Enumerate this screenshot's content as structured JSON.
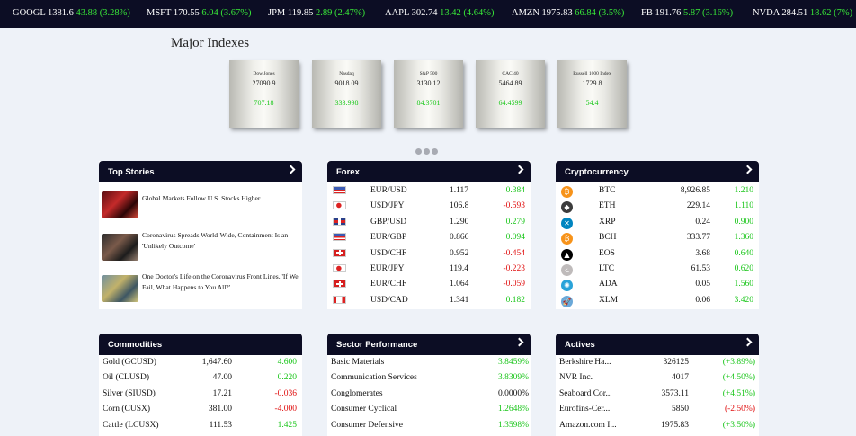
{
  "ticker": [
    {
      "sym": "GOOGL",
      "price": "1381.6",
      "chg": "43.88 (3.28%)"
    },
    {
      "sym": "MSFT",
      "price": "170.55",
      "chg": "6.04 (3.67%)"
    },
    {
      "sym": "JPM",
      "price": "119.85",
      "chg": "2.89 (2.47%)"
    },
    {
      "sym": "AAPL",
      "price": "302.74",
      "chg": "13.42 (4.64%)"
    },
    {
      "sym": "AMZN",
      "price": "1975.83",
      "chg": "66.84 (3.5%)"
    },
    {
      "sym": "FB",
      "price": "191.76",
      "chg": "5.87 (3.16%)"
    },
    {
      "sym": "NVDA",
      "price": "284.51",
      "chg": "18.62 (7%)"
    }
  ],
  "indexes": {
    "title": "Major Indexes",
    "items": [
      {
        "name": "Dow Jones",
        "value": "27090.9",
        "change": "707.18"
      },
      {
        "name": "Nasdaq",
        "value": "9018.09",
        "change": "333.998"
      },
      {
        "name": "S&P 500",
        "value": "3130.12",
        "change": "84.3701"
      },
      {
        "name": "CAC 40",
        "value": "5464.89",
        "change": "64.4599"
      },
      {
        "name": "Russell 1000 Index",
        "value": "1729.8",
        "change": "54.4"
      }
    ]
  },
  "top_stories": {
    "title": "Top Stories",
    "items": [
      {
        "headline": "Global Markets Follow U.S. Stocks Higher",
        "thumb_icon": "market-screen-thumbnail"
      },
      {
        "headline": "Coronavirus Spreads World-Wide, Containment Is an 'Unlikely Outcome'",
        "thumb_icon": "crowd-masks-thumbnail"
      },
      {
        "headline": "One Doctor's Life on the Coronavirus Front Lines. 'If We Fail, What Happens to You All?'",
        "thumb_icon": "doctor-thumbnail"
      }
    ]
  },
  "forex": {
    "title": "Forex",
    "rows": [
      {
        "pair": "EUR/USD",
        "rate": "1.117",
        "change": "0.384",
        "dir": "pos"
      },
      {
        "pair": "USD/JPY",
        "rate": "106.8",
        "change": "-0.593",
        "dir": "neg"
      },
      {
        "pair": "GBP/USD",
        "rate": "1.290",
        "change": "0.279",
        "dir": "pos"
      },
      {
        "pair": "EUR/GBP",
        "rate": "0.866",
        "change": "0.094",
        "dir": "pos"
      },
      {
        "pair": "USD/CHF",
        "rate": "0.952",
        "change": "-0.454",
        "dir": "neg"
      },
      {
        "pair": "EUR/JPY",
        "rate": "119.4",
        "change": "-0.223",
        "dir": "neg"
      },
      {
        "pair": "EUR/CHF",
        "rate": "1.064",
        "change": "-0.059",
        "dir": "neg"
      },
      {
        "pair": "USD/CAD",
        "rate": "1.341",
        "change": "0.182",
        "dir": "pos"
      }
    ]
  },
  "crypto": {
    "title": "Cryptocurrency",
    "rows": [
      {
        "sym": "BTC",
        "price": "8,926.85",
        "change": "1.210",
        "color": "#f7931a",
        "glyph": "₿"
      },
      {
        "sym": "ETH",
        "price": "229.14",
        "change": "1.110",
        "color": "#3c3c3d",
        "glyph": "◆"
      },
      {
        "sym": "XRP",
        "price": "0.24",
        "change": "0.900",
        "color": "#0085c0",
        "glyph": "✕"
      },
      {
        "sym": "BCH",
        "price": "333.77",
        "change": "1.360",
        "color": "#f7931a",
        "glyph": "₿"
      },
      {
        "sym": "EOS",
        "price": "3.68",
        "change": "0.640",
        "color": "#000000",
        "glyph": "▲"
      },
      {
        "sym": "LTC",
        "price": "61.53",
        "change": "0.620",
        "color": "#bfbbbb",
        "glyph": "Ł"
      },
      {
        "sym": "ADA",
        "price": "0.05",
        "change": "1.560",
        "color": "#2aa3d9",
        "glyph": "✺"
      },
      {
        "sym": "XLM",
        "price": "0.06",
        "change": "3.420",
        "color": "#6aa8d8",
        "glyph": "🚀"
      }
    ]
  },
  "commodities": {
    "title": "Commodities",
    "rows": [
      {
        "name": "Gold (GCUSD)",
        "price": "1,647.60",
        "change": "4.600",
        "dir": "pos"
      },
      {
        "name": "Oil (CLUSD)",
        "price": "47.00",
        "change": "0.220",
        "dir": "pos"
      },
      {
        "name": "Silver (SIUSD)",
        "price": "17.21",
        "change": "-0.036",
        "dir": "neg"
      },
      {
        "name": "Corn (CUSX)",
        "price": "381.00",
        "change": "-4.000",
        "dir": "neg"
      },
      {
        "name": "Cattle (LCUSX)",
        "price": "111.53",
        "change": "1.425",
        "dir": "pos"
      }
    ]
  },
  "sectors": {
    "title": "Sector Performance",
    "rows": [
      {
        "name": "Basic Materials",
        "change": "3.8459%",
        "dir": "pos"
      },
      {
        "name": "Communication Services",
        "change": "3.8309%",
        "dir": "pos"
      },
      {
        "name": "Conglomerates",
        "change": "0.0000%",
        "dir": "neutral"
      },
      {
        "name": "Consumer Cyclical",
        "change": "1.2648%",
        "dir": "pos"
      },
      {
        "name": "Consumer Defensive",
        "change": "1.3598%",
        "dir": "pos"
      }
    ]
  },
  "actives": {
    "title": "Actives",
    "rows": [
      {
        "name": "Berkshire Ha...",
        "price": "326125",
        "change": "(+3.89%)",
        "dir": "pos"
      },
      {
        "name": "NVR Inc.",
        "price": "4017",
        "change": "(+4.50%)",
        "dir": "pos"
      },
      {
        "name": "Seaboard Cor...",
        "price": "3573.11",
        "change": "(+4.51%)",
        "dir": "pos"
      },
      {
        "name": "Eurofins-Cer...",
        "price": "5850",
        "change": "(-2.50%)",
        "dir": "neg"
      },
      {
        "name": "Amazon.com I...",
        "price": "1975.83",
        "change": "(+3.50%)",
        "dir": "pos"
      }
    ]
  }
}
